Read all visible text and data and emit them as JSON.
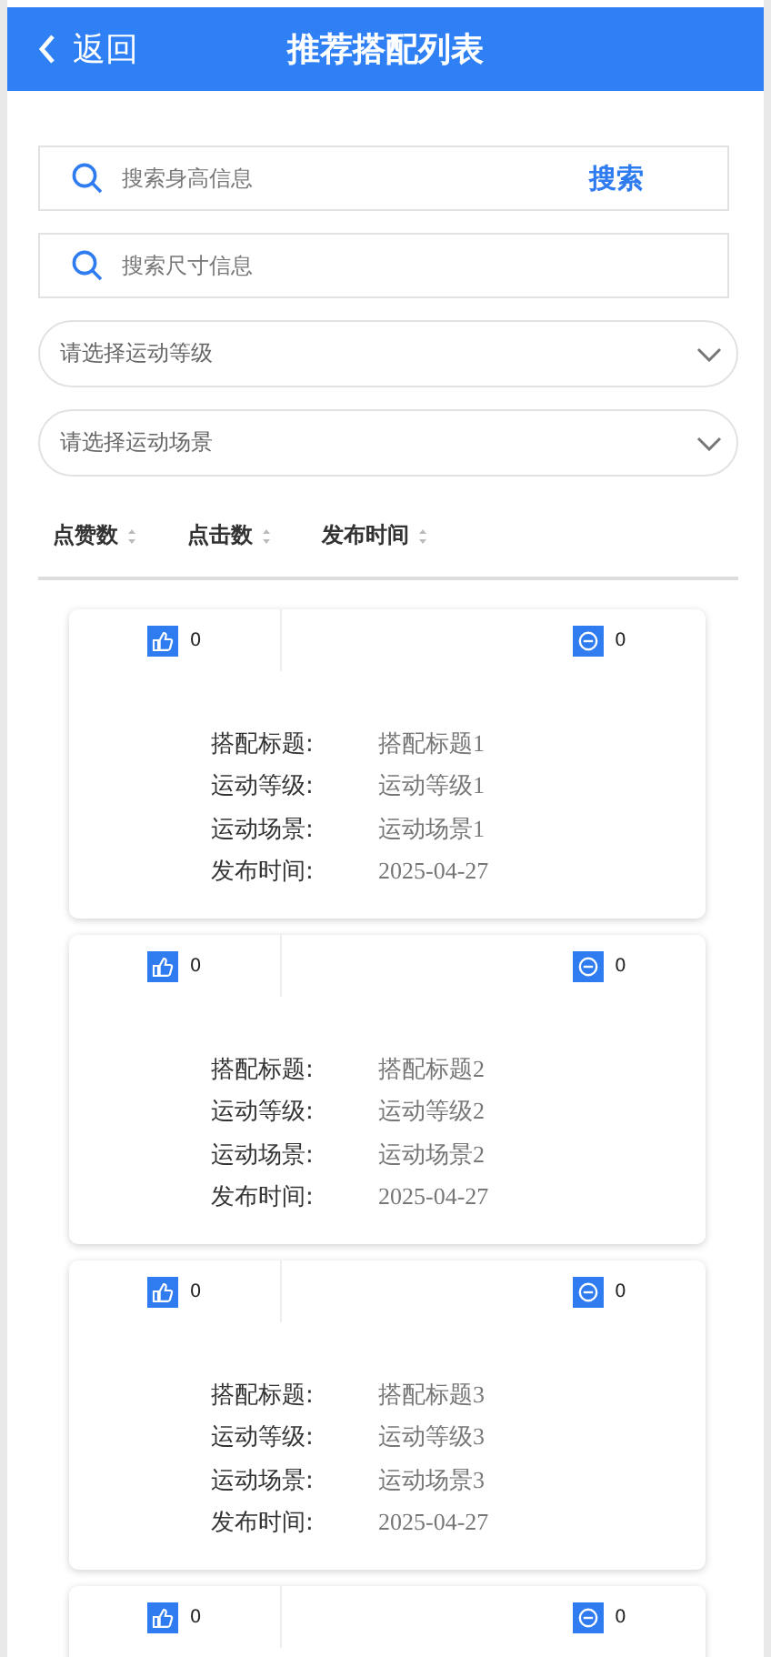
{
  "header": {
    "back": "返回",
    "title": "推荐搭配列表"
  },
  "search_fields": [
    {
      "placeholder": "搜索身高信息",
      "button": "搜索"
    },
    {
      "placeholder": "搜索尺寸信息"
    }
  ],
  "selects": [
    {
      "placeholder": "请选择运动等级"
    },
    {
      "placeholder": "请选择运动场景"
    }
  ],
  "sort_options": [
    "点赞数",
    "点击数",
    "发布时间"
  ],
  "cards": [
    {
      "likes": "0",
      "dislikes": "0",
      "fields": [
        {
          "label": "搭配标题:",
          "value": "搭配标题1"
        },
        {
          "label": "运动等级:",
          "value": "运动等级1"
        },
        {
          "label": "运动场景:",
          "value": "运动场景1"
        },
        {
          "label": "发布时间:",
          "value": "2025-04-27"
        }
      ]
    },
    {
      "likes": "0",
      "dislikes": "0",
      "fields": [
        {
          "label": "搭配标题:",
          "value": "搭配标题2"
        },
        {
          "label": "运动等级:",
          "value": "运动等级2"
        },
        {
          "label": "运动场景:",
          "value": "运动场景2"
        },
        {
          "label": "发布时间:",
          "value": "2025-04-27"
        }
      ]
    },
    {
      "likes": "0",
      "dislikes": "0",
      "fields": [
        {
          "label": "搭配标题:",
          "value": "搭配标题3"
        },
        {
          "label": "运动等级:",
          "value": "运动等级3"
        },
        {
          "label": "运动场景:",
          "value": "运动场景3"
        },
        {
          "label": "发布时间:",
          "value": "2025-04-27"
        }
      ]
    },
    {
      "likes": "0",
      "dislikes": "0"
    }
  ]
}
